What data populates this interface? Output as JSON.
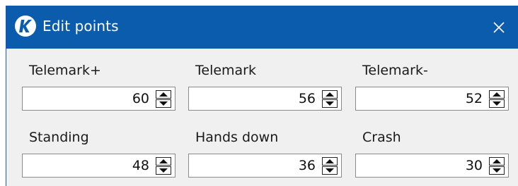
{
  "window": {
    "title": "Edit points",
    "logo_icon": "k-logo-icon",
    "close_icon": "close-icon",
    "accent_color": "#0b5cad"
  },
  "fields": [
    {
      "label": "Telemark+",
      "value": "60"
    },
    {
      "label": "Telemark",
      "value": "56"
    },
    {
      "label": "Telemark-",
      "value": "52"
    },
    {
      "label": "Standing",
      "value": "48"
    },
    {
      "label": "Hands down",
      "value": "36"
    },
    {
      "label": "Crash",
      "value": "30"
    }
  ]
}
